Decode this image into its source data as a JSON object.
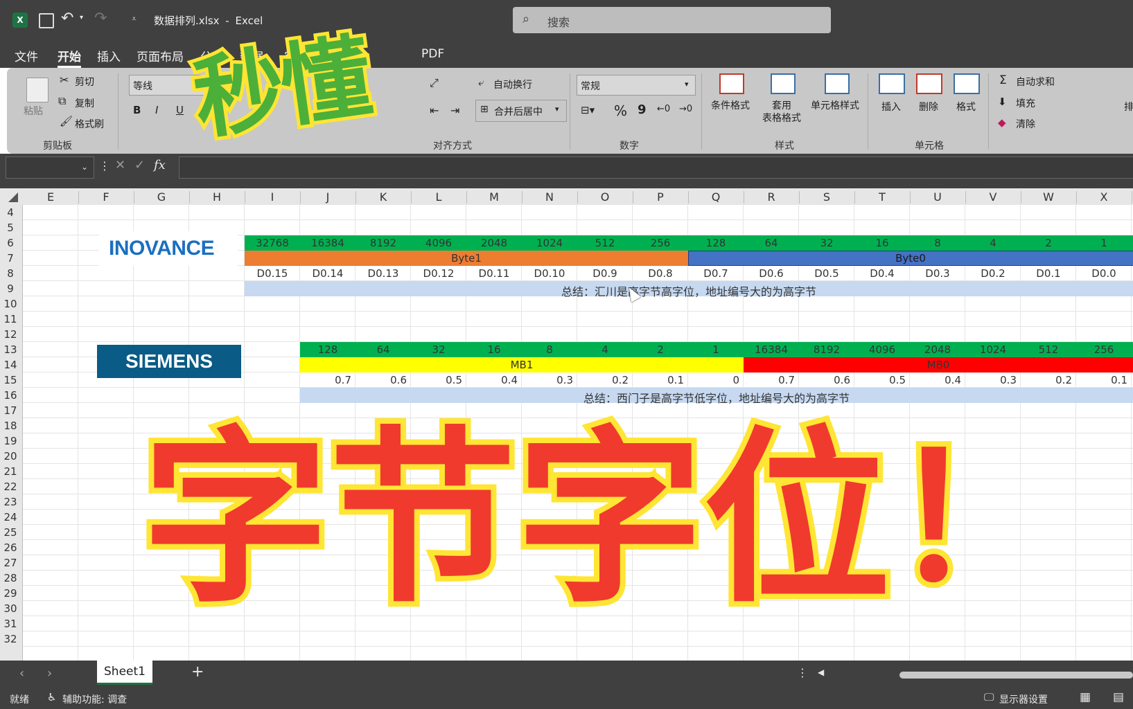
{
  "title": {
    "filename": "数据排列.xlsx",
    "separator": "-",
    "app": "Excel",
    "search_placeholder": "搜索"
  },
  "menu": [
    "文件",
    "开始",
    "插入",
    "页面布局",
    "公式",
    "数据",
    "审阅",
    "视图",
    "PDF"
  ],
  "ribbon": {
    "clipboard": {
      "paste": "粘贴",
      "cut": "剪切",
      "copy": "复制",
      "format_painter": "格式刷",
      "group": "剪贴板"
    },
    "font": {
      "name": "等线",
      "bold": "B",
      "italic": "I",
      "underline": "U"
    },
    "alignment": {
      "wrap": "自动换行",
      "merge": "合并后居中",
      "group": "对齐方式"
    },
    "number": {
      "format": "常规",
      "percent": "%",
      "comma": "9",
      "group": "数字"
    },
    "styles": {
      "conditional": "条件格式",
      "table_l1": "套用",
      "table_l2": "表格格式",
      "cell_styles": "单元格样式",
      "group": "样式"
    },
    "cells": {
      "insert": "插入",
      "delete": "删除",
      "format": "格式",
      "group": "单元格"
    },
    "editing": {
      "autosum": "自动求和",
      "fill": "填充",
      "clear": "清除",
      "sort": "排"
    }
  },
  "formula": {
    "fx": "fx"
  },
  "columns": [
    "E",
    "F",
    "G",
    "H",
    "I",
    "J",
    "K",
    "L",
    "M",
    "N",
    "O",
    "P",
    "Q",
    "R",
    "S",
    "T",
    "U",
    "V",
    "W",
    "X"
  ],
  "rows": [
    "4",
    "5",
    "6",
    "7",
    "8",
    "9",
    "10",
    "11",
    "12",
    "13",
    "14",
    "15",
    "16",
    "17",
    "18",
    "19",
    "20",
    "21",
    "22",
    "23",
    "24",
    "25",
    "26",
    "27",
    "28",
    "29",
    "30",
    "31",
    "32"
  ],
  "inovance": {
    "logo": "INOVANCE",
    "weights": [
      "32768",
      "16384",
      "8192",
      "4096",
      "2048",
      "1024",
      "512",
      "256",
      "128",
      "64",
      "32",
      "16",
      "8",
      "4",
      "2",
      "1"
    ],
    "byte1": "Byte1",
    "byte0": "Byte0",
    "bits": [
      "D0.15",
      "D0.14",
      "D0.13",
      "D0.12",
      "D0.11",
      "D0.10",
      "D0.9",
      "D0.8",
      "D0.7",
      "D0.6",
      "D0.5",
      "D0.4",
      "D0.3",
      "D0.2",
      "D0.1",
      "D0.0"
    ],
    "summary": "总结：汇川是高字节高字位，地址编号大的为高字节"
  },
  "siemens": {
    "logo": "SIEMENS",
    "weights": [
      "128",
      "64",
      "32",
      "16",
      "8",
      "4",
      "2",
      "1",
      "16384",
      "8192",
      "4096",
      "2048",
      "1024",
      "512",
      "256"
    ],
    "mb1": "MB1",
    "mb0": "MB0",
    "bits": [
      "0.7",
      "0.6",
      "0.5",
      "0.4",
      "0.3",
      "0.2",
      "0.1",
      "0",
      "0.7",
      "0.6",
      "0.5",
      "0.4",
      "0.3",
      "0.2",
      "0.1"
    ],
    "summary": "总结：西门子是高字节低字位，地址编号大的为高字节"
  },
  "overlay": {
    "top": "秒懂",
    "main": [
      "字",
      "节",
      "字",
      "位",
      "！"
    ]
  },
  "tabs": {
    "sheet": "Sheet1",
    "add": "+"
  },
  "status": {
    "ready": "就绪",
    "accessibility": "辅助功能: 调查",
    "display": "显示器设置"
  },
  "colors": {
    "green": "#00b050",
    "orange": "#ed7d31",
    "blue": "#4472c4",
    "lightblue": "#c6d9f1",
    "yellow": "#ffff00",
    "red": "#ff0000",
    "overlay_red": "#f03a2e",
    "overlay_yellow": "#ffe534",
    "overlay_green": "#4caf39",
    "inovance_blue": "#1b6fc0",
    "siemens_bg": "#0a5b86"
  }
}
